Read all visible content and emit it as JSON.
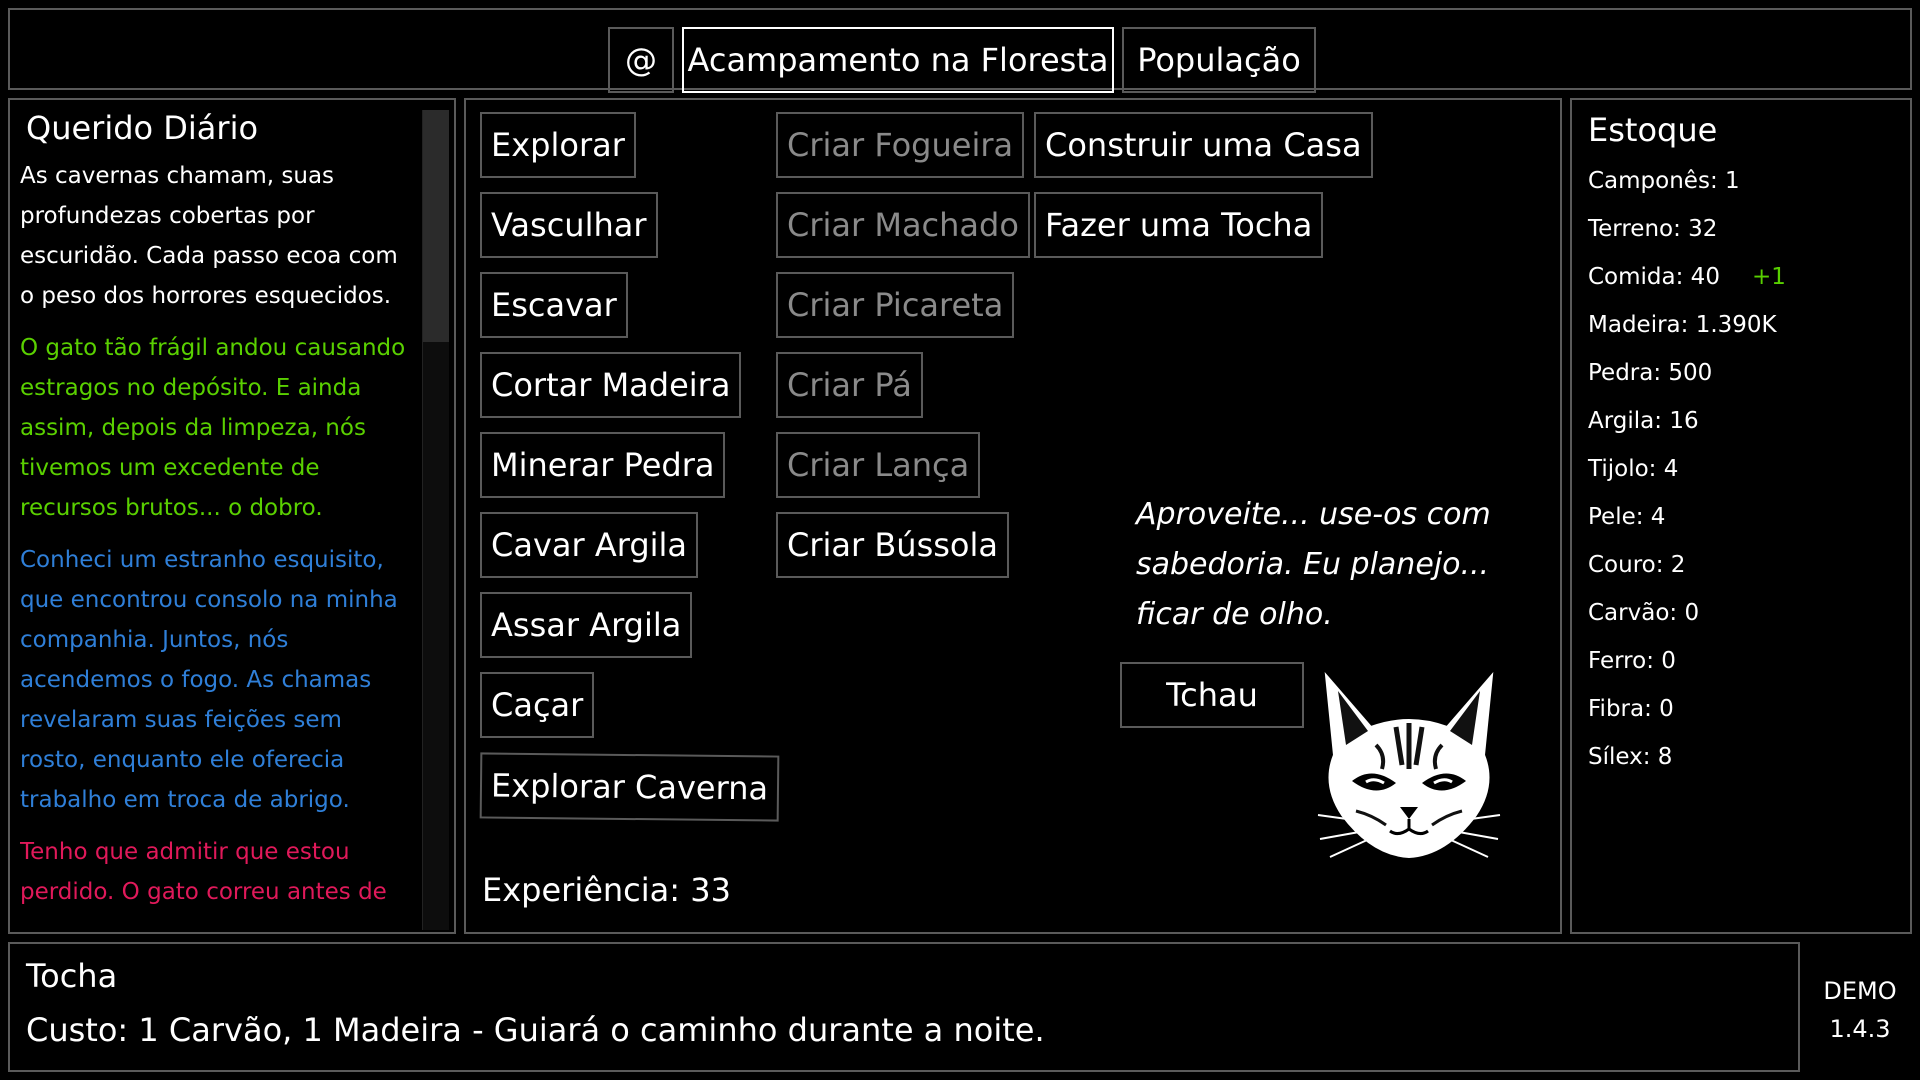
{
  "tabs": [
    {
      "label": "@"
    },
    {
      "label": "Acampamento na Floresta"
    },
    {
      "label": "População"
    }
  ],
  "journal": {
    "title": "Querido Diário",
    "entries": [
      {
        "text": "As cavernas chamam, suas profundezas cobertas por escuridão. Cada passo ecoa com o peso dos horrores esquecidos.",
        "color": "#ffffff"
      },
      {
        "text": "O gato tão frágil andou causando estragos no depósito. E ainda assim, depois da limpeza, nós tivemos um excedente de recursos brutos... o dobro.",
        "color": "#5ad000"
      },
      {
        "text": "Conheci um estranho esquisito, que encontrou consolo na minha companhia. Juntos, nós acendemos o fogo. As chamas revelaram suas feições sem rosto, enquanto ele oferecia trabalho em troca de abrigo.",
        "color": "#2f7fd8"
      },
      {
        "text": "Tenho que admitir que estou perdido. O gato correu antes de",
        "color": "#e0195a"
      }
    ]
  },
  "actions": {
    "col1": [
      "Explorar",
      "Vasculhar",
      "Escavar",
      "Cortar Madeira",
      "Minerar Pedra",
      "Cavar Argila",
      "Assar Argila",
      "Caçar",
      "Explorar Caverna"
    ],
    "col2": [
      "Criar Fogueira",
      "Criar Machado",
      "Criar Picareta",
      "Criar Pá",
      "Criar Lança",
      "Criar Bússola"
    ],
    "col3": [
      "Construir uma Casa",
      "Fazer uma Tocha"
    ],
    "experience": "Experiência: 33"
  },
  "dialogue": {
    "text": "Aproveite... use-os com sabedoria. Eu planejo... ficar de olho.",
    "button": "Tchau",
    "portrait": "cat-face-icon"
  },
  "stock": {
    "title": "Estoque",
    "items": [
      "Camponês: 1",
      "Terreno: 32",
      "Comida: 40",
      "Madeira: 1.390K",
      "Pedra: 500",
      "Argila: 16",
      "Tijolo: 4",
      "Pele: 4",
      "Couro: 2",
      "Carvão: 0",
      "Ferro: 0",
      "Fibra: 0",
      "Sílex: 8"
    ],
    "food_delta": "+1",
    "delta_color": "#58d000"
  },
  "tooltip": {
    "title": "Tocha",
    "description": "Custo: 1 Carvão, 1 Madeira - Guiará o caminho durante a noite."
  },
  "version": {
    "label": "DEMO",
    "number": "1.4.3"
  }
}
